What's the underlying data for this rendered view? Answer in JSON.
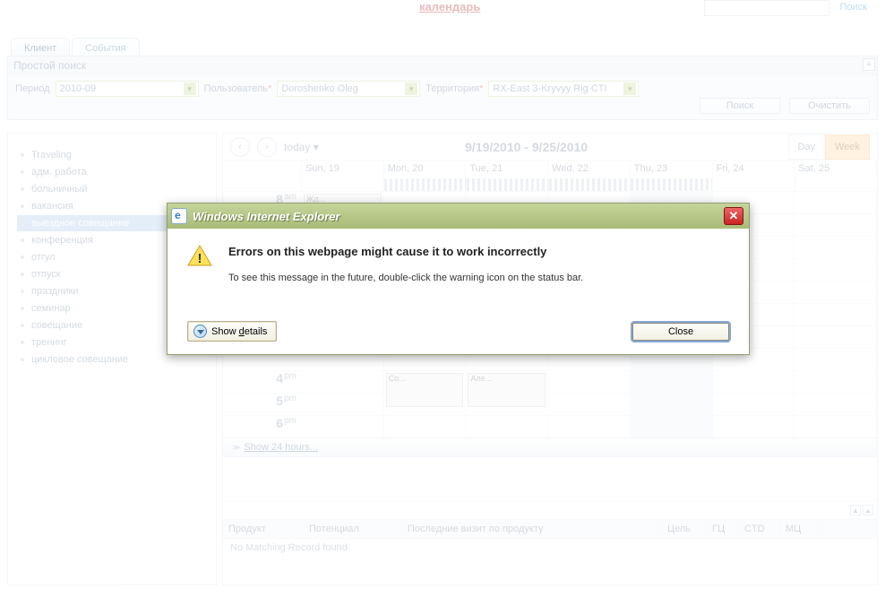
{
  "top": {
    "kalendar": "календарь",
    "search_link": "Поиск"
  },
  "tabs": {
    "client": "Клиент",
    "events": "События"
  },
  "searchpanel": {
    "title": "Простой поиск",
    "period_label": "Период",
    "period_value": "2010-09",
    "user_label": "Пользователь",
    "user_value": "Doroshenko Oleg",
    "territory_label": "Территория",
    "territory_value": "RX-East 3-Kryvyy Rig CTI",
    "search_btn": "Поиск",
    "clear_btn": "Очистить",
    "add": "+",
    "star": "*"
  },
  "sidebar": {
    "items": [
      "Traveling",
      "адм. работа",
      "больничный",
      "вакансия",
      "выездное совещание",
      "конференция",
      "отгул",
      "отпуск",
      "праздники",
      "семинар",
      "совещание",
      "тренинг",
      "цикловое совещание"
    ],
    "selected_index": 4
  },
  "calendar": {
    "today": "today",
    "range": "9/19/2010 - 9/25/2010",
    "day_btn": "Day",
    "week_btn": "Week",
    "days": [
      "Sun, 19",
      "Mon, 20",
      "Tue, 21",
      "Wed, 22",
      "Thu, 23",
      "Fri, 24",
      "Sat, 25"
    ],
    "hours": [
      "8",
      "4",
      "5",
      "6"
    ],
    "ampm": [
      "am",
      "pm",
      "pm",
      "pm"
    ],
    "event1": "Жд...",
    "event2": "Co...",
    "event3": "Але...",
    "show24": "Show 24 hours..."
  },
  "bottom": {
    "cols": [
      "Продукт",
      "Потенциал",
      "Последние визит по продукту",
      "Цель",
      "ГЦ",
      "CTD",
      "МЦ"
    ],
    "nomatch": "No Matching Record found"
  },
  "dialog": {
    "title": "Windows Internet Explorer",
    "heading": "Errors on this webpage might cause it to work incorrectly",
    "body": "To see this message in the future, double-click the warning icon on the status bar.",
    "show_details": "Show details",
    "close": "Close",
    "x": "✕"
  }
}
